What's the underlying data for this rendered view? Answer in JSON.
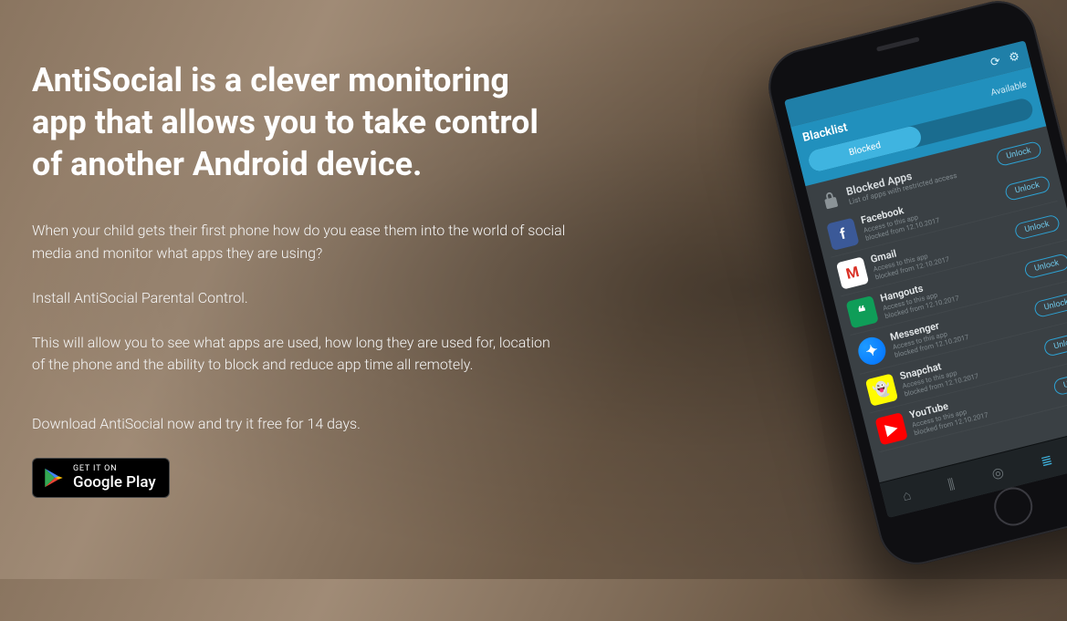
{
  "headline": "AntiSocial is a clever monitoring app that allows you to take control of another Android device.",
  "paragraphs": {
    "p1": "When your child gets their first phone how do you ease them into the world of social media and monitor what apps they are using?",
    "p2": "Install AntiSocial Parental Control.",
    "p3": "This will allow you to see what apps are used, how long they are used for, location of the phone and the ability to block and reduce app time all remotely.",
    "p4": "Download AntiSocial now and try it free for 14 days."
  },
  "store_badge": {
    "line1": "GET IT ON",
    "line2": "Google Play"
  },
  "phone": {
    "tabs": {
      "header": "Blacklist",
      "available": "Available",
      "tab1": "Blocked",
      "tab2": ""
    },
    "section": {
      "title": "Blocked Apps",
      "subtitle": "List of apps with restricted access",
      "unlock": "Unlock"
    },
    "apps": [
      {
        "name": "Facebook",
        "sub1": "Access to this app",
        "sub2": "blocked from 12.10.2017",
        "icon": "ic-fb",
        "glyph": "f"
      },
      {
        "name": "Gmail",
        "sub1": "Access to this app",
        "sub2": "blocked from 12.10.2017",
        "icon": "ic-gm",
        "glyph": "M"
      },
      {
        "name": "Hangouts",
        "sub1": "Access to this app",
        "sub2": "blocked from 12.10.2017",
        "icon": "ic-ho",
        "glyph": "❝"
      },
      {
        "name": "Messenger",
        "sub1": "Access to this app",
        "sub2": "blocked from 12.10.2017",
        "icon": "ic-ms",
        "glyph": "✦"
      },
      {
        "name": "Snapchat",
        "sub1": "Access to this app",
        "sub2": "blocked from 12.10.2017",
        "icon": "ic-sc",
        "glyph": "👻"
      },
      {
        "name": "YouTube",
        "sub1": "Access to this app",
        "sub2": "blocked from 12.10.2017",
        "icon": "ic-yt",
        "glyph": "▶"
      }
    ],
    "unlock_label": "Unlock"
  }
}
